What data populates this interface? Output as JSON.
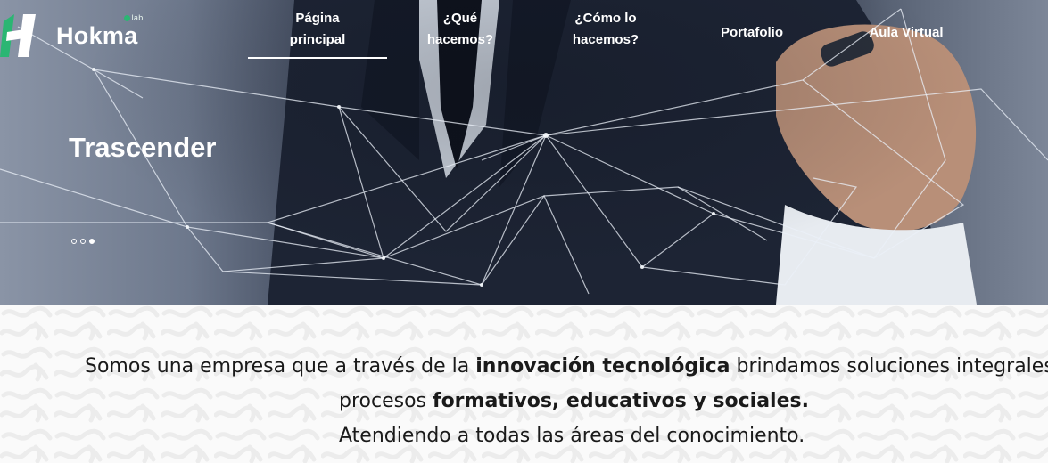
{
  "brand": {
    "name": "Hokma",
    "sublabel": "lab",
    "accent_color": "#2bb673"
  },
  "nav": {
    "items": [
      {
        "label_line1": "Página",
        "label_line2": "principal",
        "active": true
      },
      {
        "label_line1": "¿Qué",
        "label_line2": "hacemos?",
        "active": false
      },
      {
        "label_line1": "¿Cómo lo",
        "label_line2": "hacemos?",
        "active": false
      },
      {
        "label_line1": "Portafolio",
        "label_line2": "",
        "active": false
      },
      {
        "label_line1": "Aula Virtual",
        "label_line2": "",
        "active": false
      }
    ]
  },
  "hero": {
    "title": "Trascender",
    "slide_count": 3,
    "active_slide": 3
  },
  "intro": {
    "line1_prefix": "Somos una empresa que a través de la ",
    "line1_bold": "innovación tecnológica",
    "line1_suffix": " brindamos soluciones integrales en",
    "line2_prefix": "procesos ",
    "line2_bold": "formativos, educativos y sociales.",
    "line3": "Atendiendo a todas las áreas del conocimiento."
  }
}
